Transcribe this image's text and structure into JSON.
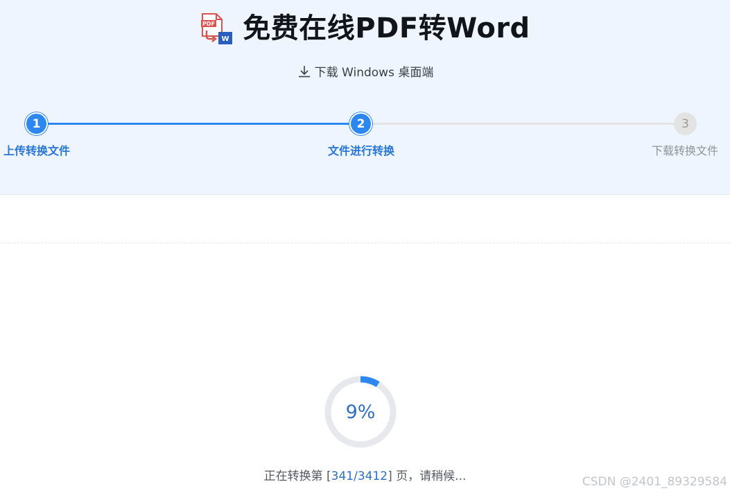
{
  "header": {
    "title": "免费在线PDF转Word",
    "logo_icon": "pdf-to-word-icon",
    "logo_pdf_text": "PDF",
    "logo_word_text": "W",
    "download_label": "下载 Windows 桌面端",
    "download_icon": "download-icon"
  },
  "stepper": {
    "steps": [
      {
        "number": "1",
        "label": "上传转换文件",
        "state": "complete"
      },
      {
        "number": "2",
        "label": "文件进行转换",
        "state": "current"
      },
      {
        "number": "3",
        "label": "下载转换文件",
        "state": "pending"
      }
    ]
  },
  "progress": {
    "percent_value": 9,
    "percent_label": "9%",
    "status_prefix": "正在转换第 [",
    "current_page": "341",
    "separator": "/",
    "total_pages": "3412",
    "status_suffix": "] 页，请稍候..."
  },
  "watermark": "CSDN @2401_89329584",
  "colors": {
    "accent": "#2d87f0",
    "accent_text": "#2776d8",
    "hero_bg": "#eef5fe",
    "inactive": "#e3e3e3",
    "ring_track": "#e6e8ec"
  }
}
